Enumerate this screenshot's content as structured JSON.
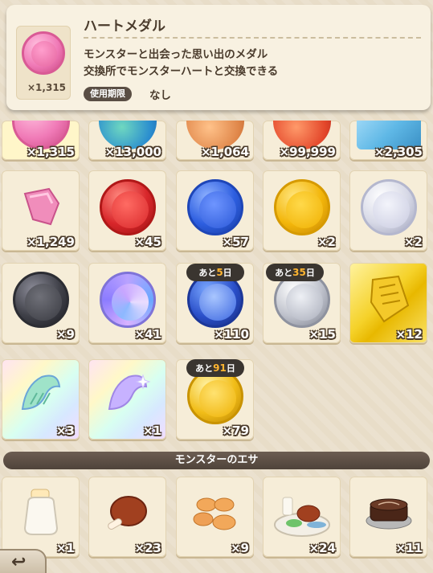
{
  "detail": {
    "title": "ハートメダル",
    "count": "×1,315",
    "desc_line1": "モンスターと出会った思い出のメダル",
    "desc_line2": "交換所でモンスターハートと交換できる",
    "period_label": "使用期限",
    "period_value": "なし",
    "icon": "heart-medal-icon"
  },
  "row0": [
    {
      "count": "×1,315",
      "icon": "pink-heart-medal-icon"
    },
    {
      "count": "×13,000",
      "icon": "blue-green-medal-icon"
    },
    {
      "count": "×1,064",
      "icon": "orange-medal-icon"
    },
    {
      "count": "×99,999",
      "icon": "red-orange-medal-icon"
    },
    {
      "count": "×2,305",
      "icon": "light-blue-item-icon"
    }
  ],
  "row1": [
    {
      "count": "×1,249",
      "icon": "pink-heart-fragment-icon"
    },
    {
      "count": "×45",
      "icon": "red-coin-icon"
    },
    {
      "count": "×57",
      "icon": "blue-coin-icon"
    },
    {
      "count": "×2",
      "icon": "yellow-coin-icon"
    },
    {
      "count": "×2",
      "icon": "silver-coin-icon"
    }
  ],
  "row2": [
    {
      "count": "×9",
      "icon": "black-coin-icon"
    },
    {
      "count": "×41",
      "icon": "purple-swirl-coin-icon"
    },
    {
      "count": "×110",
      "icon": "wolf-coin-icon",
      "timer_prefix": "あと",
      "timer_num": "5",
      "timer_suffix": "日"
    },
    {
      "count": "×15",
      "icon": "eye-coin-icon",
      "timer_prefix": "あと",
      "timer_num": "35",
      "timer_suffix": "日"
    },
    {
      "count": "×12",
      "icon": "gold-ticket-icon"
    }
  ],
  "row3": [
    {
      "count": "×3",
      "icon": "rainbow-wing-icon"
    },
    {
      "count": "×1",
      "icon": "rainbow-sparkle-wing-icon"
    },
    {
      "count": "×79",
      "icon": "gold-dragon-coin-icon",
      "timer_prefix": "あと",
      "timer_num": "91",
      "timer_suffix": "日"
    }
  ],
  "section": {
    "title": "モンスターのエサ"
  },
  "food": [
    {
      "count": "×1",
      "icon": "milk-bottle-icon"
    },
    {
      "count": "×23",
      "icon": "meat-icon"
    },
    {
      "count": "×9",
      "icon": "cookies-icon"
    },
    {
      "count": "×24",
      "icon": "feast-platter-icon"
    },
    {
      "count": "×11",
      "icon": "chocolate-cake-icon"
    }
  ],
  "back": {
    "icon": "back-arrow-icon"
  }
}
